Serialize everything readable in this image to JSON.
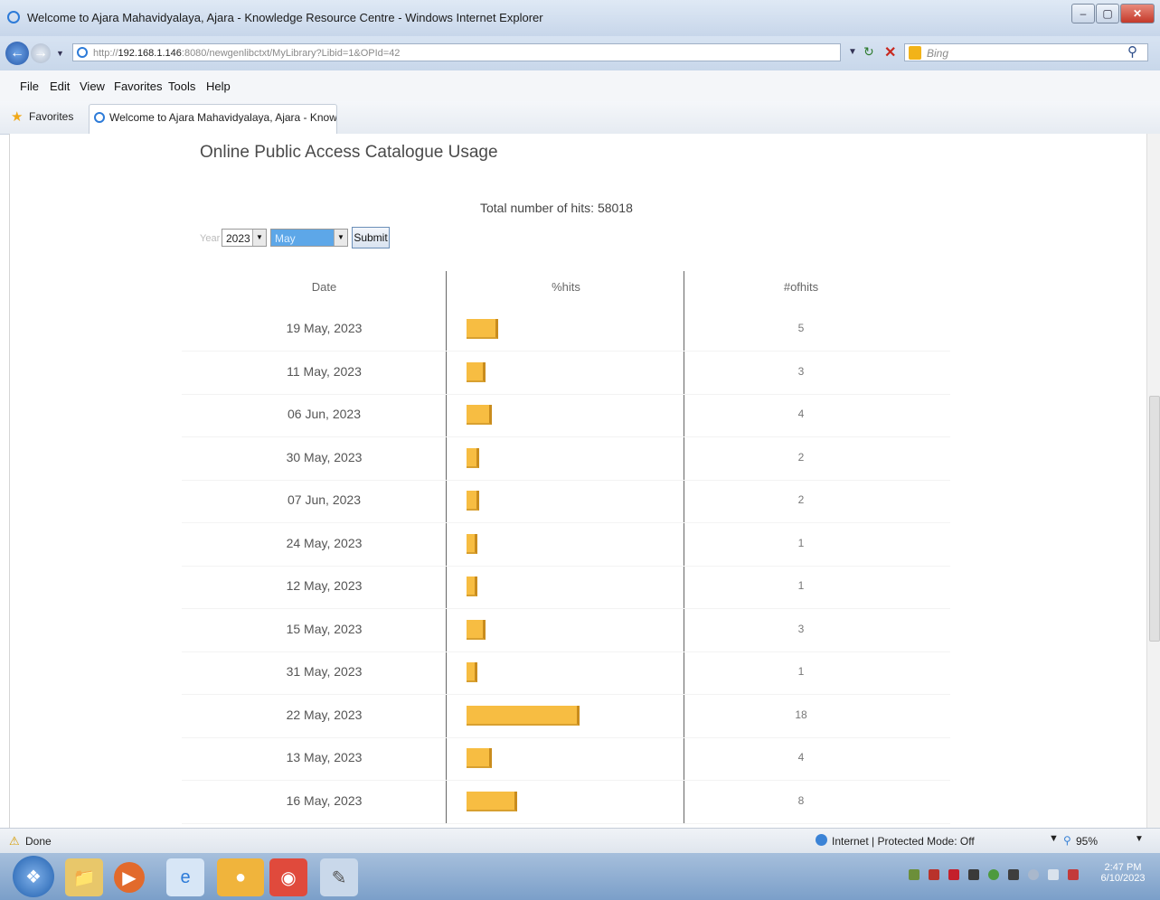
{
  "window": {
    "title": "Welcome to Ajara Mahavidyalaya, Ajara - Knowledge Resource Centre - Windows Internet Explorer",
    "controls": [
      "–",
      "▢",
      "✕"
    ]
  },
  "address": {
    "url_prefix": "http://",
    "url_host": "192.168.1.146",
    "url_rest": ":8080/newgenlibctxt/MyLibrary?Libid=1&OPId=42",
    "search_placeholder": "Bing"
  },
  "menu": [
    "File",
    "Edit",
    "View",
    "Favorites",
    "Tools",
    "Help"
  ],
  "favorites": {
    "label": "Favorites",
    "tab_title": "Welcome to Ajara Mahavidyalaya, Ajara - Knowle..."
  },
  "page": {
    "title": "Online Public Access Catalogue Usage",
    "total_hits": "Total number of hits: 58018",
    "year_label": "Year",
    "year_value": "2023",
    "month_value": "May",
    "submit_label": "Submit",
    "headers": {
      "date": "Date",
      "pct": "%hits",
      "count": "#ofhits"
    },
    "rows": [
      {
        "date": "19 May, 2023",
        "hits": "5"
      },
      {
        "date": "11 May, 2023",
        "hits": "3"
      },
      {
        "date": "06 Jun, 2023",
        "hits": "4"
      },
      {
        "date": "30 May, 2023",
        "hits": "2"
      },
      {
        "date": "07 Jun, 2023",
        "hits": "2"
      },
      {
        "date": "24 May, 2023",
        "hits": "1"
      },
      {
        "date": "12 May, 2023",
        "hits": "1"
      },
      {
        "date": "15 May, 2023",
        "hits": "3"
      },
      {
        "date": "31 May, 2023",
        "hits": "1"
      },
      {
        "date": "22 May, 2023",
        "hits": "18"
      },
      {
        "date": "13 May, 2023",
        "hits": "4"
      },
      {
        "date": "16 May, 2023",
        "hits": "8"
      }
    ],
    "bar_color": "#f7bd42"
  },
  "status": {
    "left": "Done",
    "zone": "Internet | Protected Mode: Off",
    "zoom": "95%"
  },
  "taskbar": {
    "time": "2:47 PM",
    "date": "6/10/2023"
  }
}
